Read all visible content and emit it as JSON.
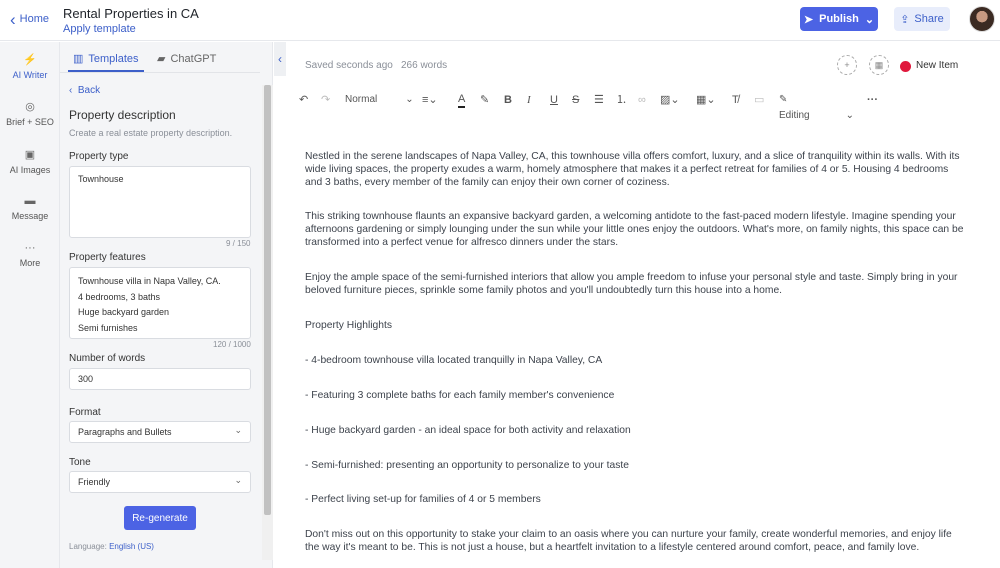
{
  "header": {
    "home": "Home",
    "title": "Rental Properties in CA",
    "apply_template": "Apply template",
    "publish": "Publish",
    "share": "Share"
  },
  "nav": [
    {
      "label": "AI Writer",
      "icon": "lightning-icon"
    },
    {
      "label": "Brief + SEO",
      "icon": "target-icon"
    },
    {
      "label": "AI Images",
      "icon": "image-icon"
    },
    {
      "label": "Message",
      "icon": "message-icon"
    },
    {
      "label": "More",
      "icon": "more-icon"
    }
  ],
  "panel": {
    "tab_templates": "Templates",
    "tab_chatgpt": "ChatGPT",
    "back": "Back",
    "title": "Property description",
    "description": "Create a real estate property description.",
    "type_label": "Property type",
    "type_value": "Townhouse",
    "type_count": "9 / 150",
    "features_label": "Property features",
    "features": [
      "Townhouse villa in Napa Valley, CA.",
      "4 bedrooms, 3 baths",
      "Huge backyard garden",
      "Semi furnishes"
    ],
    "features_count": "120 / 1000",
    "words_label": "Number of words",
    "words_value": "300",
    "format_label": "Format",
    "format_value": "Paragraphs and Bullets",
    "tone_label": "Tone",
    "tone_value": "Friendly",
    "regenerate": "Re-generate",
    "language_label": "Language:",
    "language_value": "English (US)"
  },
  "editor": {
    "saved": "Saved seconds ago",
    "word_count": "266 words",
    "new_item": "New Item",
    "style": "Normal",
    "mode": "Editing",
    "content": [
      "Nestled in the serene landscapes of Napa Valley, CA, this townhouse villa offers comfort, luxury, and a slice of tranquility within its walls. With its wide living spaces, the property exudes a warm, homely atmosphere that makes it a perfect retreat for families of 4 or 5. Housing 4 bedrooms and 3 baths, every member of the family can enjoy their own corner of coziness.",
      "This striking townhouse flaunts an expansive backyard garden, a welcoming antidote to the fast-paced modern lifestyle. Imagine spending your afternoons gardening or simply lounging under the sun while your little ones enjoy the outdoors. What's more, on family nights, this space can be transformed into a perfect venue for alfresco dinners under the stars.",
      "Enjoy the ample space of the semi-furnished interiors that allow you ample freedom to infuse your personal style and taste. Simply bring in your beloved furniture pieces, sprinkle some family photos and you'll undoubtedly turn this house into a home.",
      "Property Highlights",
      "- 4-bedroom townhouse villa located tranquilly in Napa Valley, CA",
      "- Featuring 3 complete baths for each family member's convenience",
      "- Huge backyard garden - an ideal space for both activity and relaxation",
      "- Semi-furnished: presenting an opportunity to personalize to your taste",
      "- Perfect living set-up for families of 4 or 5 members",
      "Don't miss out on this opportunity to stake your claim to an oasis where you can nurture your family, create wonderful memories, and enjoy life the way it's meant to be. This is not just a house, but a heartfelt invitation to a lifestyle centered around comfort, peace, and family love."
    ]
  }
}
